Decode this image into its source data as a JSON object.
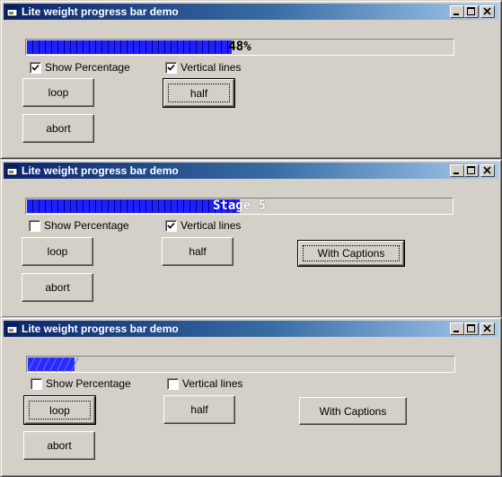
{
  "windows": [
    {
      "title": "Lite weight progress bar demo",
      "progress": {
        "value": 0.48,
        "text": "48%",
        "style": "vertical-lines"
      },
      "show_percentage": {
        "label": "Show Percentage",
        "checked": true
      },
      "vertical_lines": {
        "label": "Vertical lines",
        "checked": true
      },
      "buttons": {
        "loop": "loop",
        "half": "half",
        "abort": "abort"
      }
    },
    {
      "title": "Lite weight progress bar demo",
      "progress": {
        "value": 0.5,
        "text": "Stage 5",
        "style": "vertical-lines"
      },
      "show_percentage": {
        "label": "Show Percentage",
        "checked": false
      },
      "vertical_lines": {
        "label": "Vertical lines",
        "checked": true
      },
      "buttons": {
        "loop": "loop",
        "half": "half",
        "abort": "abort",
        "captions": "With Captions"
      }
    },
    {
      "title": "Lite weight progress bar demo",
      "progress": {
        "value": 0.11,
        "text": "",
        "style": "hatched"
      },
      "show_percentage": {
        "label": "Show Percentage",
        "checked": false
      },
      "vertical_lines": {
        "label": "Vertical lines",
        "checked": false
      },
      "buttons": {
        "loop": "loop",
        "half": "half",
        "abort": "abort",
        "captions": "With Captions"
      }
    }
  ],
  "icons": {
    "title": "app-window-icon",
    "min": "minimize-icon",
    "max": "maximize-icon",
    "close": "close-icon",
    "check": "checkmark-icon"
  },
  "colors": {
    "progress_fill": "#0000ff",
    "titlebar_start": "#0a246a",
    "titlebar_end": "#a6caf0"
  }
}
